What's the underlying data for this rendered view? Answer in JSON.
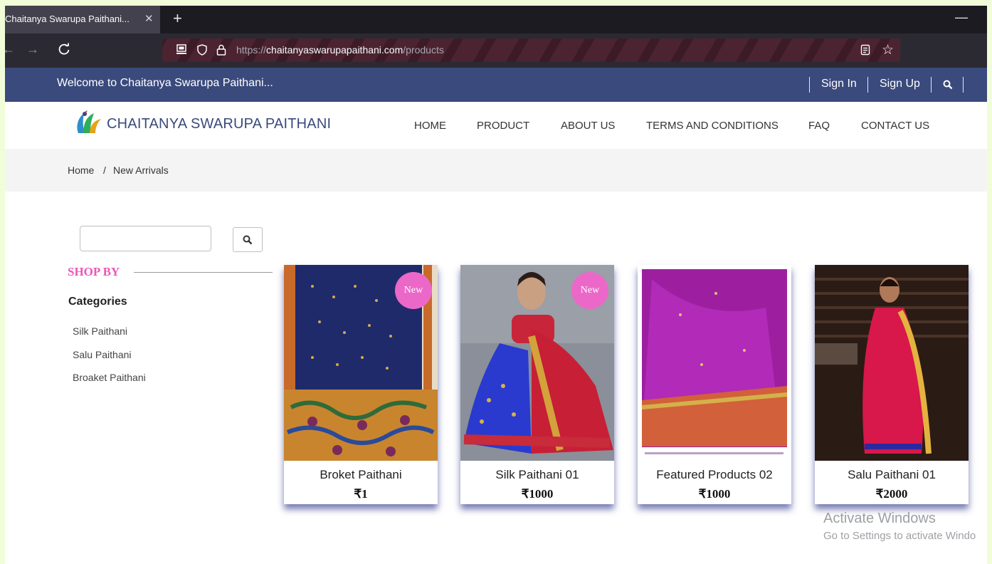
{
  "browser": {
    "tab_title": "Chaitanya Swarupa Paithani...",
    "tab_close": "✕",
    "new_tab": "+",
    "minimize": "—",
    "url_scheme": "https://",
    "url_host": "chaitanyaswarupapaithani.com",
    "url_path": "/products"
  },
  "topbar": {
    "welcome": "Welcome to Chaitanya Swarupa Paithani...",
    "sign_in": "Sign In",
    "sign_up": "Sign Up"
  },
  "header": {
    "brand": "CHAITANYA SWARUPA PAITHANI",
    "menu": [
      "HOME",
      "PRODUCT",
      "ABOUT US",
      "TERMS AND CONDITIONS",
      "FAQ",
      "CONTACT US"
    ]
  },
  "breadcrumb": {
    "home": "Home",
    "sep": "/",
    "current": "New Arrivals"
  },
  "sidebar": {
    "search_value": "",
    "shop_by": "SHOP BY",
    "categories_title": "Categories",
    "categories": [
      "Silk Paithani",
      "Salu Paithani",
      "Broaket Paithani"
    ]
  },
  "products": [
    {
      "name": "Broket Paithani",
      "price": "₹1",
      "badge": "New"
    },
    {
      "name": "Silk Paithani 01",
      "price": "₹1000",
      "badge": "New"
    },
    {
      "name": "Featured Products 02",
      "price": "₹1000"
    },
    {
      "name": "Salu Paithani 01",
      "price": "₹2000"
    }
  ],
  "watermark": {
    "title": "Activate Windows",
    "subtitle": "Go to Settings to activate Windo"
  },
  "colors": {
    "page_bg": "#f1fdd9",
    "topbar": "#3a4a7c",
    "accent_pink": "#ee55b8",
    "badge": "#ec68c8"
  }
}
